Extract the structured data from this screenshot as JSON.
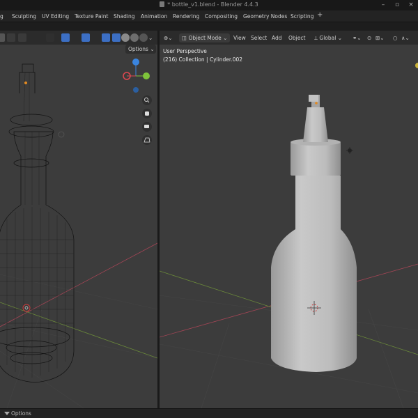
{
  "window": {
    "title": "* bottle_v1.blend - Blender 4.4.3"
  },
  "workspace_tabs": [
    {
      "label": "Sculpting"
    },
    {
      "label": "UV Editing"
    },
    {
      "label": "Texture Paint"
    },
    {
      "label": "Shading"
    },
    {
      "label": "Animation"
    },
    {
      "label": "Rendering"
    },
    {
      "label": "Compositing"
    },
    {
      "label": "Geometry Nodes"
    },
    {
      "label": "Scripting"
    }
  ],
  "left_viewport": {
    "options_label": "Options",
    "shading_mode": "wireframe"
  },
  "right_viewport": {
    "mode_label": "Object Mode",
    "menu": {
      "view": "View",
      "select": "Select",
      "add": "Add",
      "object": "Object"
    },
    "transform_orientation": "Global",
    "perspective_label": "User Perspective",
    "collection_label": "(216) Collection | Cylinder.002",
    "shading_mode": "solid"
  },
  "statusbar": {
    "options_label": "Options"
  },
  "colors": {
    "viewport_bg": "#3c3c3c",
    "grid_x_axis": "#a24555",
    "grid_y_axis": "#6b8a3a",
    "gizmo_x": "#e04850",
    "gizmo_y": "#7ec43a",
    "gizmo_z": "#3a85e0"
  }
}
